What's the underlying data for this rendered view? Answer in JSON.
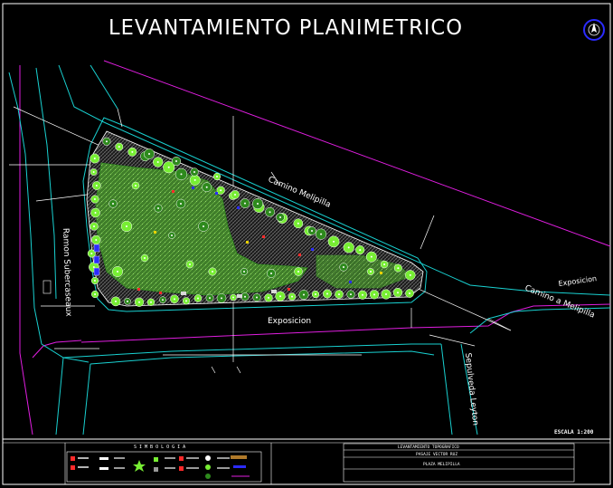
{
  "drawing": {
    "title": "LEVANTAMIENTO     PLANIMETRICO",
    "scale_label": "ESCALA  1:200",
    "colors": {
      "background": "#000000",
      "curb": "#19d1d1",
      "property_line": "#e01ee0",
      "lines": "#ffffff",
      "tree": "#77ee33",
      "tree_dark": "#2e8a1d",
      "lawn": "#5fae3a",
      "accent_blue": "#2b2bff",
      "accent_red": "#ff2a2a",
      "accent_yellow": "#e8d000"
    }
  },
  "streets": {
    "camino_melipilla_upper": "Camino Melipilla",
    "camino_a_melipilla": "Camino  a  Melipilla",
    "exposicion_right": "Exposicion",
    "exposicion_bottom": "Exposicion",
    "ramon_subercaseaux": "Ramon  Subercaseaux",
    "sepulveda_leyton": "Sepulveda   Leyton"
  },
  "legend": {
    "title": "S I M B O L O G I A"
  },
  "title_block": {
    "line1": "LEVANTAMIENTO TOPOGRAFICO",
    "line2": "PASAJE  VECTOR  RUZ",
    "line3": "PLAZA  MELIPILLA"
  }
}
